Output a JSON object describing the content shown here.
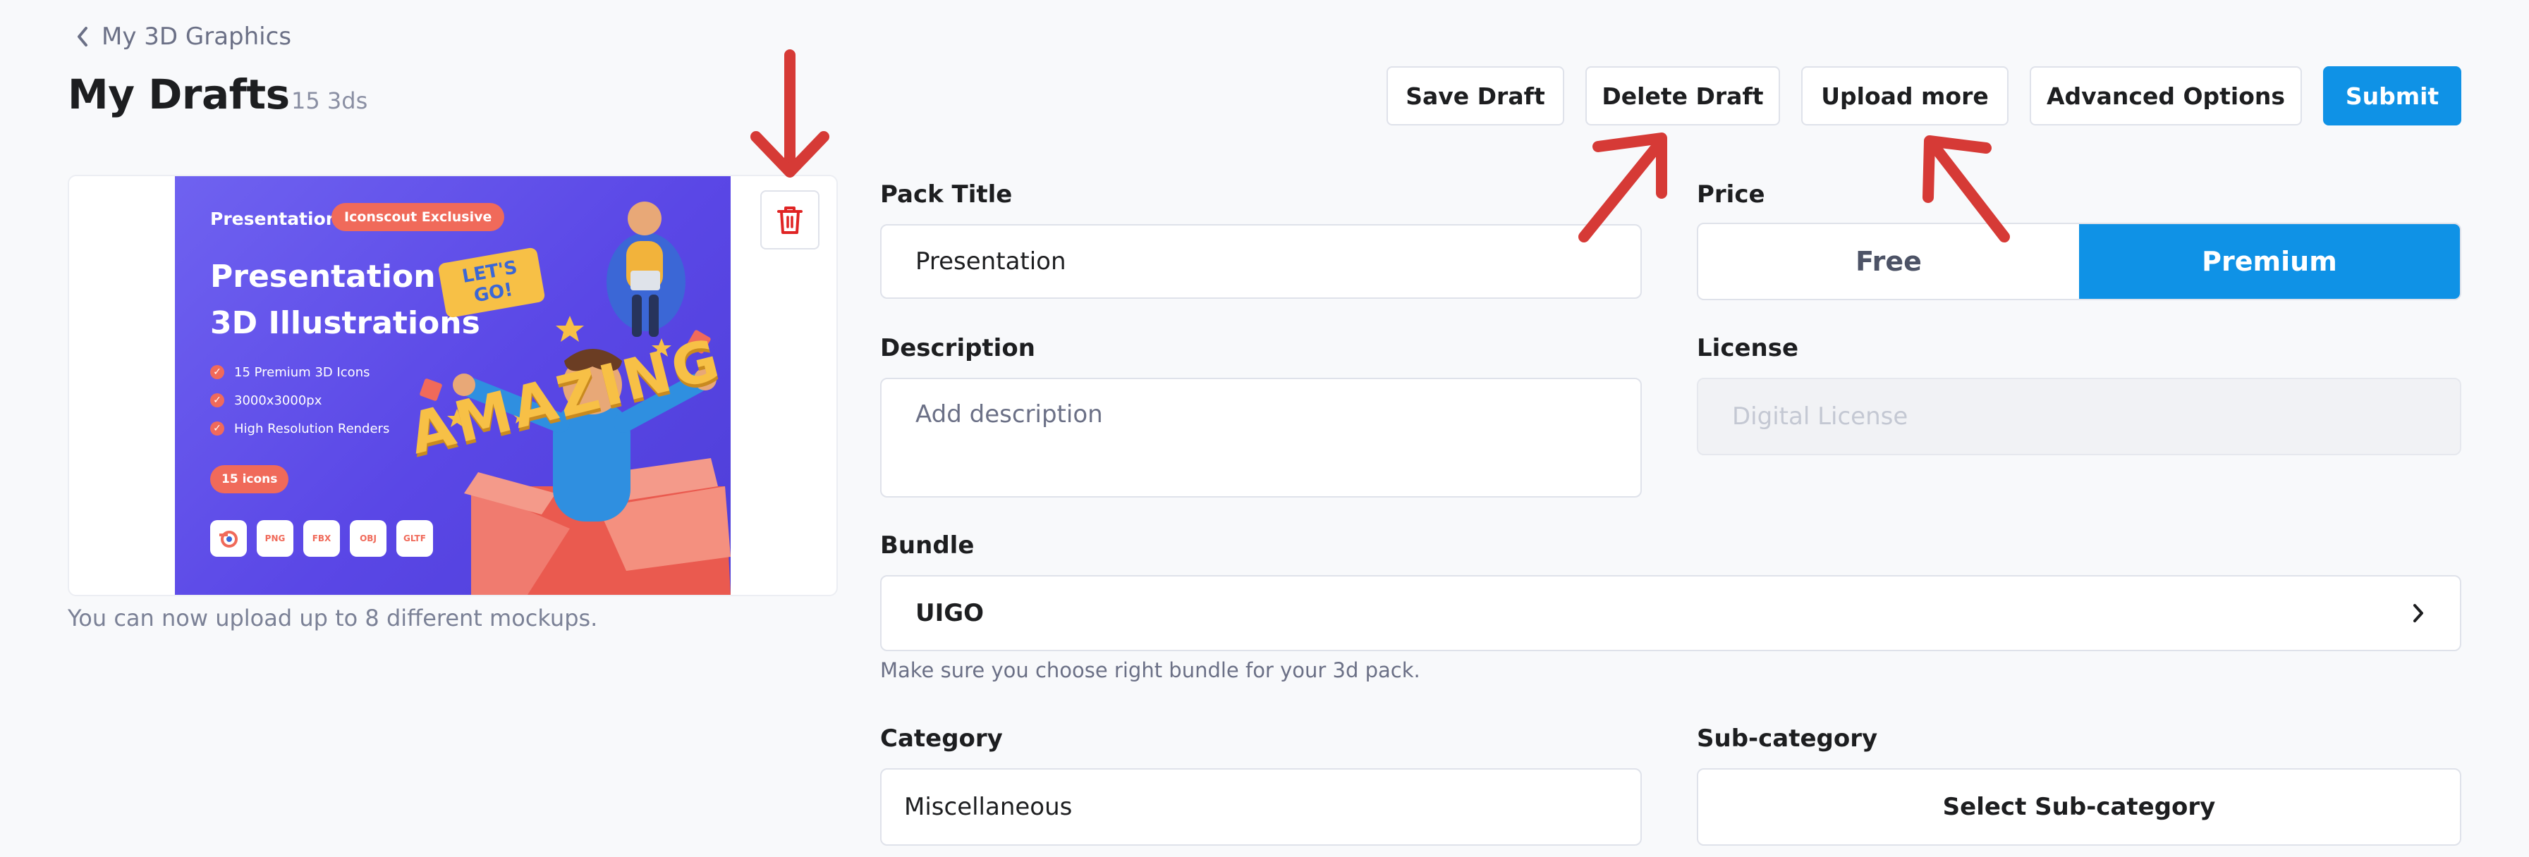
{
  "header": {
    "back_label": "My 3D Graphics",
    "title": "My Drafts",
    "count": "15 3ds"
  },
  "toolbar": {
    "save_draft": "Save Draft",
    "delete_draft": "Delete Draft",
    "upload_more": "Upload more",
    "advanced_options": "Advanced Options",
    "submit": "Submit"
  },
  "mockup": {
    "brand": "Presentation",
    "badge": "Iconscout Exclusive",
    "headline_line1": "Presentation",
    "headline_line2": "3D Illustrations",
    "features": [
      "15 Premium 3D Icons",
      "3000x3000px",
      "High Resolution Renders"
    ],
    "pill": "15 icons",
    "formats": [
      "PNG",
      "FBX",
      "OBJ",
      "GLTF"
    ],
    "art_text_1": "LET'S GO!",
    "art_text_2": "AMAZING",
    "hint": "You can now upload up to 8 different mockups."
  },
  "form": {
    "pack_title": {
      "label": "Pack Title",
      "value": "Presentation"
    },
    "price": {
      "label": "Price",
      "options": [
        "Free",
        "Premium"
      ],
      "selected": "Premium"
    },
    "description": {
      "label": "Description",
      "placeholder": "Add description",
      "value": ""
    },
    "license": {
      "label": "License",
      "value": "Digital License"
    },
    "bundle": {
      "label": "Bundle",
      "value": "UIGO",
      "help": "Make sure you choose right bundle for your 3d pack."
    },
    "category": {
      "label": "Category",
      "value": "Miscellaneous"
    },
    "sub_category": {
      "label": "Sub-category",
      "value": "Select Sub-category"
    }
  },
  "colors": {
    "primary": "#0f92e6",
    "annotation": "#d63a36",
    "delete_icon": "#e02424",
    "accent_mockup": "#f06a5a",
    "mockup_bg": "#5a47e6"
  },
  "icons": [
    "chevron-left-icon",
    "trash-icon",
    "chevron-right-icon",
    "annotation-arrow"
  ]
}
